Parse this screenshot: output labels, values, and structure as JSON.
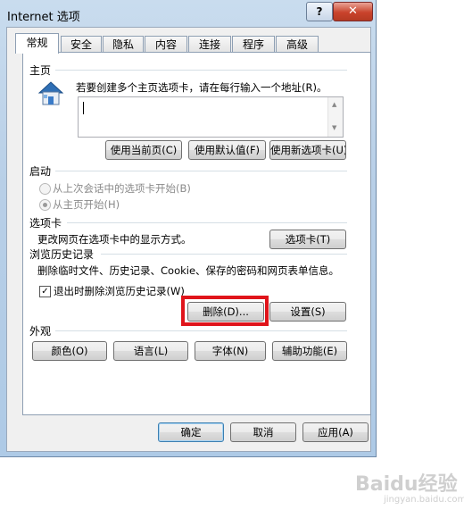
{
  "window": {
    "title": "Internet 选项",
    "help_label": "?",
    "close_label": "✕"
  },
  "tabs": [
    {
      "label": "常规"
    },
    {
      "label": "安全"
    },
    {
      "label": "隐私"
    },
    {
      "label": "内容"
    },
    {
      "label": "连接"
    },
    {
      "label": "程序"
    },
    {
      "label": "高级"
    }
  ],
  "home": {
    "heading": "主页",
    "description": "若要创建多个主页选项卡，请在每行输入一个地址(R)。",
    "address_value": "",
    "buttons": {
      "current": "使用当前页(C)",
      "default": "使用默认值(F)",
      "new_tab": "使用新选项卡(U)"
    }
  },
  "startup": {
    "heading": "启动",
    "options": [
      {
        "label": "从上次会话中的选项卡开始(B)",
        "selected": false
      },
      {
        "label": "从主页开始(H)",
        "selected": true
      }
    ]
  },
  "tabs_section": {
    "heading": "选项卡",
    "description": "更改网页在选项卡中的显示方式。",
    "button": "选项卡(T)"
  },
  "history": {
    "heading": "浏览历史记录",
    "description": "删除临时文件、历史记录、Cookie、保存的密码和网页表单信息。",
    "checkbox_label": "退出时删除浏览历史记录(W)",
    "checkbox_checked": true,
    "delete_button": "删除(D)...",
    "settings_button": "设置(S)"
  },
  "appearance": {
    "heading": "外观",
    "buttons": {
      "colors": "颜色(O)",
      "languages": "语言(L)",
      "fonts": "字体(N)",
      "accessibility": "辅助功能(E)"
    }
  },
  "footer": {
    "ok": "确定",
    "cancel": "取消",
    "apply": "应用(A)"
  },
  "watermark": {
    "main": "Baidu经验",
    "sub": "jingyan.baidu.com"
  }
}
